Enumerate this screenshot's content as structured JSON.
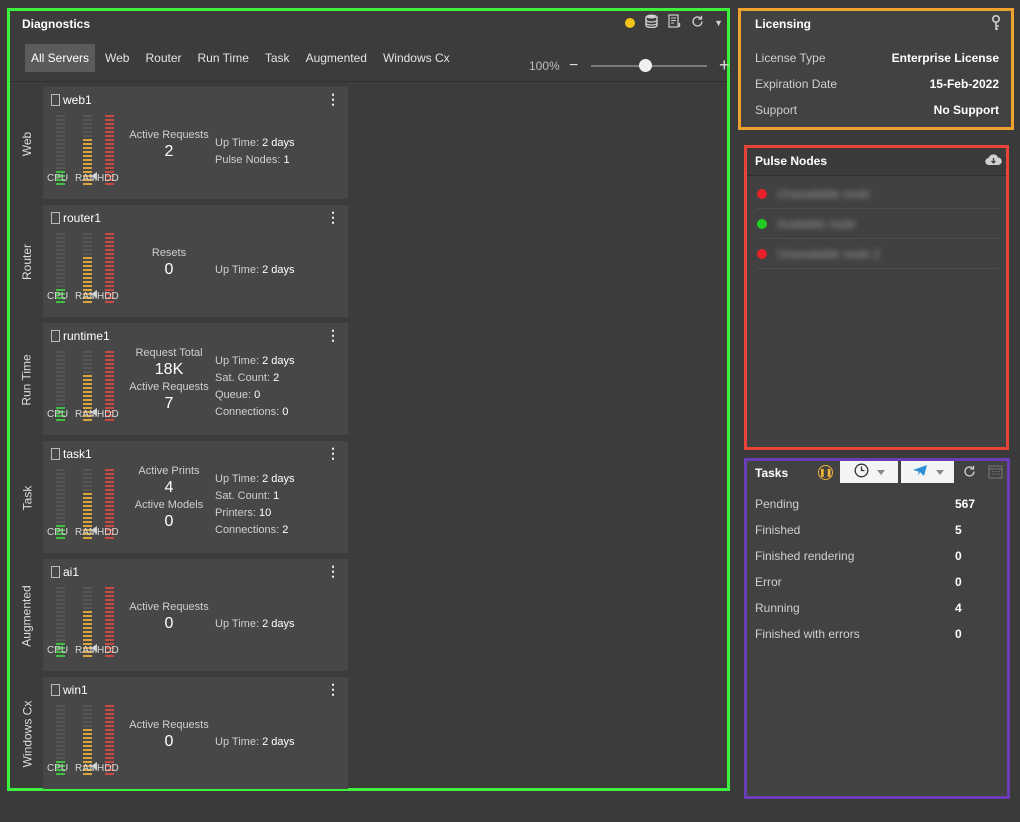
{
  "diagnostics": {
    "title": "Diagnostics",
    "icons": [
      "status-dot-icon",
      "database-icon",
      "log-icon",
      "refresh-icon",
      "chevron-down-icon"
    ],
    "tabs": [
      "All Servers",
      "Web",
      "Router",
      "Run Time",
      "Task",
      "Augmented",
      "Windows Cx"
    ],
    "active_tab": "All Servers",
    "zoom": {
      "label": "100%",
      "minus": "−",
      "plus": "+",
      "slider_fraction": 0.47
    },
    "meter_labels": {
      "cpu": "CPU",
      "ram": "RAM",
      "hdd": "HDD"
    },
    "servers": [
      {
        "group": "Web",
        "name": "web1",
        "cpu_level": 0.2,
        "ram_level": 0.65,
        "hdd_level": 1.0,
        "stats": [
          {
            "label": "Active Requests",
            "value": "2"
          }
        ],
        "info": [
          {
            "label": "Up Time:",
            "value": "2 days"
          },
          {
            "label": "Pulse Nodes:",
            "value": "1"
          }
        ]
      },
      {
        "group": "Router",
        "name": "router1",
        "cpu_level": 0.2,
        "ram_level": 0.65,
        "hdd_level": 1.0,
        "stats": [
          {
            "label": "Resets",
            "value": "0"
          }
        ],
        "info": [
          {
            "label": "Up Time:",
            "value": "2 days"
          }
        ]
      },
      {
        "group": "Run Time",
        "name": "runtime1",
        "cpu_level": 0.2,
        "ram_level": 0.65,
        "hdd_level": 1.0,
        "stats": [
          {
            "label": "Request Total",
            "value": "18K"
          },
          {
            "label": "Active Requests",
            "value": "7"
          }
        ],
        "info": [
          {
            "label": "Up Time:",
            "value": "2 days"
          },
          {
            "label": "Sat. Count:",
            "value": "2"
          },
          {
            "label": "Queue:",
            "value": "0"
          },
          {
            "label": "Connections:",
            "value": "0"
          }
        ]
      },
      {
        "group": "Task",
        "name": "task1",
        "cpu_level": 0.2,
        "ram_level": 0.65,
        "hdd_level": 1.0,
        "stats": [
          {
            "label": "Active Prints",
            "value": "4"
          },
          {
            "label": "Active Models",
            "value": "0"
          }
        ],
        "info": [
          {
            "label": "Up Time:",
            "value": "2 days"
          },
          {
            "label": "Sat. Count:",
            "value": "1"
          },
          {
            "label": "Printers:",
            "value": "10"
          },
          {
            "label": "Connections:",
            "value": "2"
          }
        ]
      },
      {
        "group": "Augmented",
        "name": "ai1",
        "cpu_level": 0.2,
        "ram_level": 0.65,
        "hdd_level": 1.0,
        "stats": [
          {
            "label": "Active Requests",
            "value": "0"
          }
        ],
        "info": [
          {
            "label": "Up Time:",
            "value": "2 days"
          }
        ]
      },
      {
        "group": "Windows Cx",
        "name": "win1",
        "cpu_level": 0.2,
        "ram_level": 0.65,
        "hdd_level": 1.0,
        "stats": [
          {
            "label": "Active Requests",
            "value": "0"
          }
        ],
        "info": [
          {
            "label": "Up Time:",
            "value": "2 days"
          }
        ]
      }
    ]
  },
  "licensing": {
    "title": "Licensing",
    "icon": "key-icon",
    "rows": [
      {
        "label": "License Type",
        "value": "Enterprise License"
      },
      {
        "label": "Expiration Date",
        "value": "15-Feb-2022"
      },
      {
        "label": "Support",
        "value": "No Support"
      }
    ]
  },
  "pulse_nodes": {
    "title": "Pulse Nodes",
    "icon": "cloud-download-icon",
    "nodes": [
      {
        "status_color": "#e8212b",
        "name": "Unavailable node"
      },
      {
        "status_color": "#22cc22",
        "name": "Available node"
      },
      {
        "status_color": "#e8212b",
        "name": "Unavailable node 2"
      }
    ]
  },
  "tasks": {
    "title": "Tasks",
    "icons": [
      "pause-icon",
      "clock-icon",
      "send-icon",
      "refresh-icon",
      "calendar-icon"
    ],
    "rows": [
      {
        "label": "Pending",
        "value": "567"
      },
      {
        "label": "Finished",
        "value": "5"
      },
      {
        "label": "Finished rendering",
        "value": "0"
      },
      {
        "label": "Error",
        "value": "0"
      },
      {
        "label": "Running",
        "value": "4"
      },
      {
        "label": "Finished with errors",
        "value": "0"
      }
    ]
  },
  "colors": {
    "diagnostics_border": "#3df23d",
    "licensing_border": "#f0a22f",
    "pulse_border": "#e8443a",
    "tasks_border": "#6a3cb6",
    "cpu": "#3fbf3f",
    "ram": "#d9a43a",
    "hdd": "#c84a43"
  }
}
